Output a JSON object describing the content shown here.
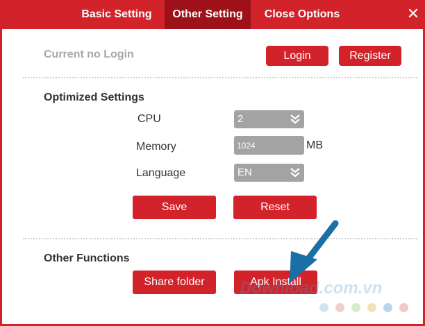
{
  "tabs": [
    {
      "label": "Basic Setting",
      "active": false
    },
    {
      "label": "Other Setting",
      "active": true
    },
    {
      "label": "Close Options",
      "active": false
    }
  ],
  "close_icon": "close-icon",
  "account": {
    "status": "Current no Login",
    "login_label": "Login",
    "register_label": "Register"
  },
  "optimized": {
    "title": "Optimized Settings",
    "cpu_label": "CPU",
    "cpu_value": "2",
    "memory_label": "Memory",
    "memory_value": "1024",
    "memory_unit": "MB",
    "language_label": "Language",
    "language_value": "EN",
    "save_label": "Save",
    "reset_label": "Reset"
  },
  "functions": {
    "title": "Other Functions",
    "share_folder_label": "Share folder",
    "apk_install_label": "Apk Install"
  },
  "watermark": "Download.com.vn",
  "colors": {
    "accent": "#d2232b",
    "tab_active": "#9e1118",
    "control_gray": "#a3a3a3",
    "arrow": "#1a6fa6",
    "dots": [
      "#cfe3f1",
      "#f1cfd1",
      "#d3ecc9",
      "#f3e2b8",
      "#b9d6ec",
      "#f1c9cc"
    ]
  }
}
